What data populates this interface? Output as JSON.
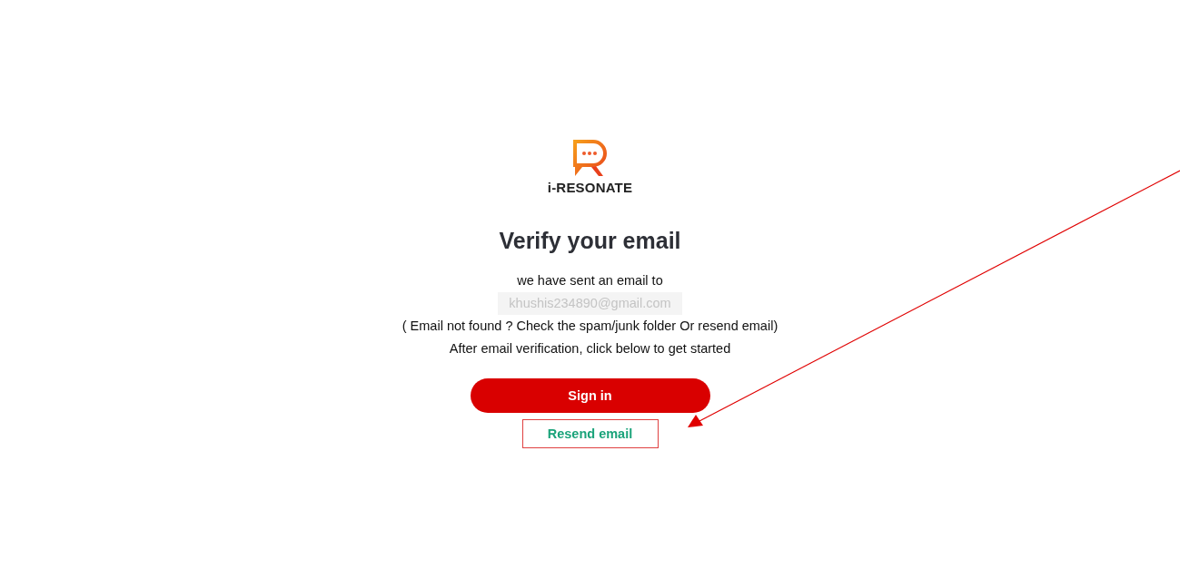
{
  "logo": {
    "name": "i-RESONATE"
  },
  "heading": "Verify your email",
  "message": "we have sent an email to",
  "email": "khushis234890@gmail.com",
  "hint": "( Email not found ? Check the spam/junk folder Or resend email)",
  "instruction": "After email verification, click below to get started",
  "buttons": [
    {
      "kind": "primary",
      "label": "Sign in"
    },
    {
      "kind": "link",
      "label": "Resend email"
    }
  ]
}
